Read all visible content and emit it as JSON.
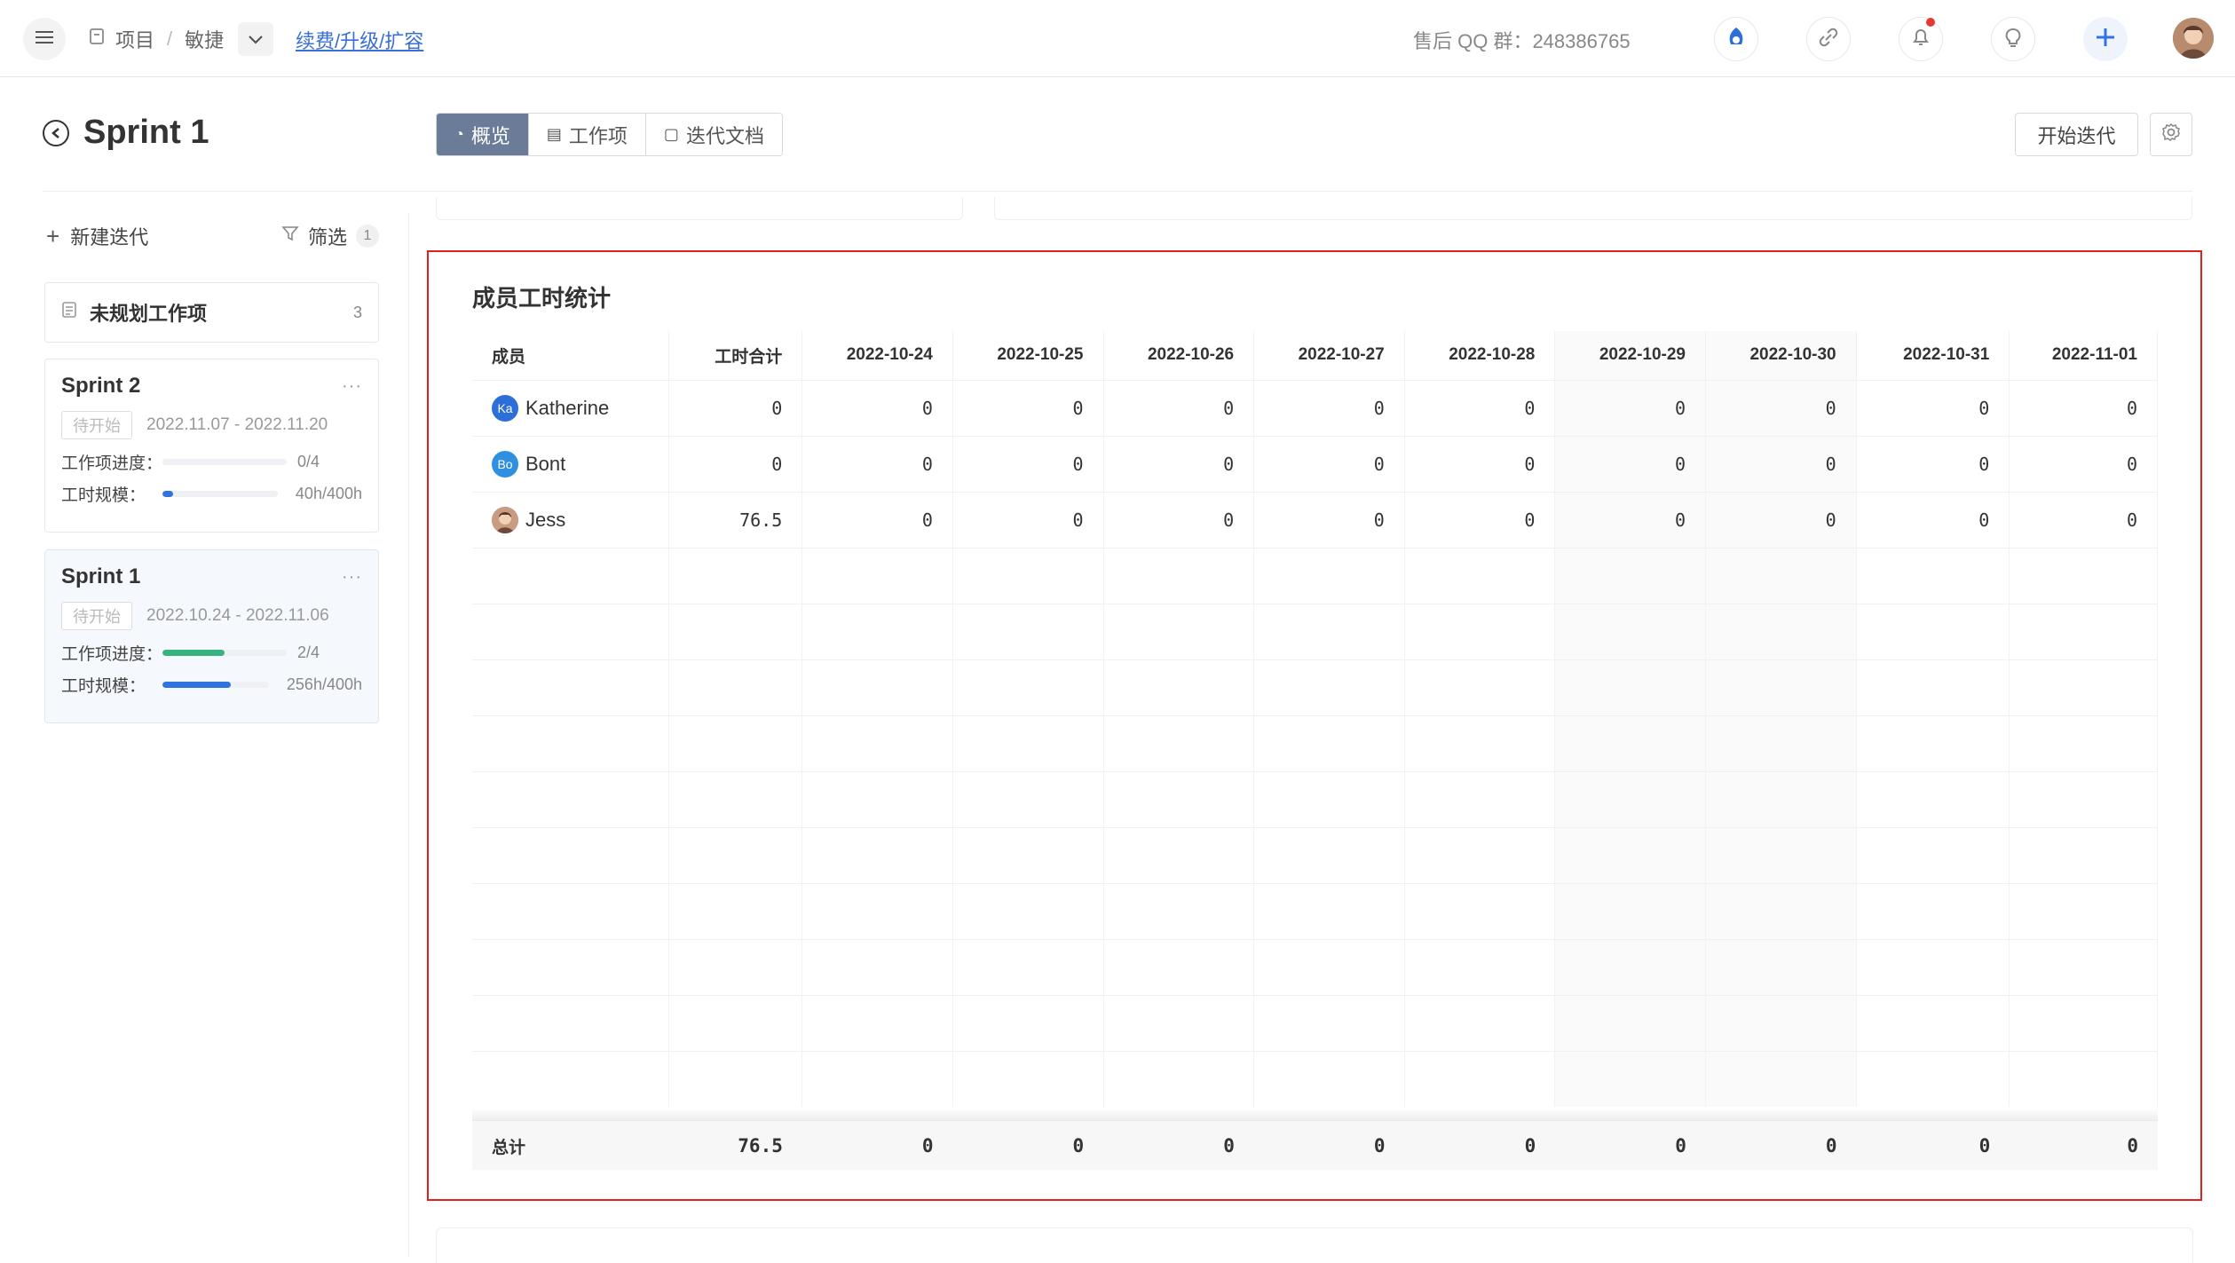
{
  "topbar": {
    "breadcrumb": [
      "项目",
      "敏捷"
    ],
    "renew_link": "续费/升级/扩容",
    "qq_group": "售后 QQ 群：248386765",
    "icons": [
      "menu-icon",
      "project-icon",
      "chevron-down-icon",
      "app-logo-icon",
      "link-icon",
      "bell-icon",
      "bulb-icon",
      "plus-icon",
      "user-avatar"
    ]
  },
  "page": {
    "title": "Sprint 1",
    "tabs": [
      {
        "label": "概览",
        "icon": "dashboard-icon",
        "active": true
      },
      {
        "label": "工作项",
        "icon": "list-icon",
        "active": false
      },
      {
        "label": "迭代文档",
        "icon": "doc-icon",
        "active": false
      }
    ],
    "start_button": "开始迭代"
  },
  "sidebar": {
    "new_sprint": "新建迭代",
    "filter_label": "筛选",
    "filter_count": "1",
    "unplanned": {
      "label": "未规划工作项",
      "count": "3"
    },
    "sprints": [
      {
        "name": "Sprint 2",
        "status": "待开始",
        "dates": "2022.11.07 - 2022.11.20",
        "progress_label": "工作项进度：",
        "progress_text": "0/4",
        "progress_frac": 0,
        "scale_label": "工时规模：",
        "scale_text": "40h/400h",
        "scale_frac": 0.1
      },
      {
        "name": "Sprint 1",
        "status": "待开始",
        "dates": "2022.10.24 - 2022.11.06",
        "progress_label": "工作项进度：",
        "progress_text": "2/4",
        "progress_frac": 0.5,
        "scale_label": "工时规模：",
        "scale_text": "256h/400h",
        "scale_frac": 0.64
      }
    ],
    "more": "···"
  },
  "worklog": {
    "title": "成员工时统计",
    "columns": [
      "成员",
      "工时合计",
      "2022-10-24",
      "2022-10-25",
      "2022-10-26",
      "2022-10-27",
      "2022-10-28",
      "2022-10-29",
      "2022-10-30",
      "2022-10-31",
      "2022-11-01"
    ],
    "rows": [
      {
        "member": "Katherine",
        "avatar_text": "Ka",
        "avatar_color": "#2d6fd8",
        "values": [
          "0",
          "0",
          "0",
          "0",
          "0",
          "0",
          "0",
          "0",
          "0",
          "0"
        ]
      },
      {
        "member": "Bont",
        "avatar_text": "Bo",
        "avatar_color": "#2f8fe0",
        "values": [
          "0",
          "0",
          "0",
          "0",
          "0",
          "0",
          "0",
          "0",
          "0",
          "0"
        ]
      },
      {
        "member": "Jess",
        "avatar_text": "",
        "avatar_color": "#c79c82",
        "values": [
          "76.5",
          "0",
          "0",
          "0",
          "0",
          "0",
          "0",
          "0",
          "0",
          "0"
        ]
      }
    ],
    "total": {
      "label": "总计",
      "values": [
        "76.5",
        "0",
        "0",
        "0",
        "0",
        "0",
        "0",
        "0",
        "0",
        "0"
      ]
    }
  },
  "colors": {
    "accent": "#3a6fd8",
    "tab_active": "#6b7c98",
    "progress_green": "#36b37e",
    "scale_blue": "#2f74e0",
    "highlight_border": "#e02020"
  }
}
